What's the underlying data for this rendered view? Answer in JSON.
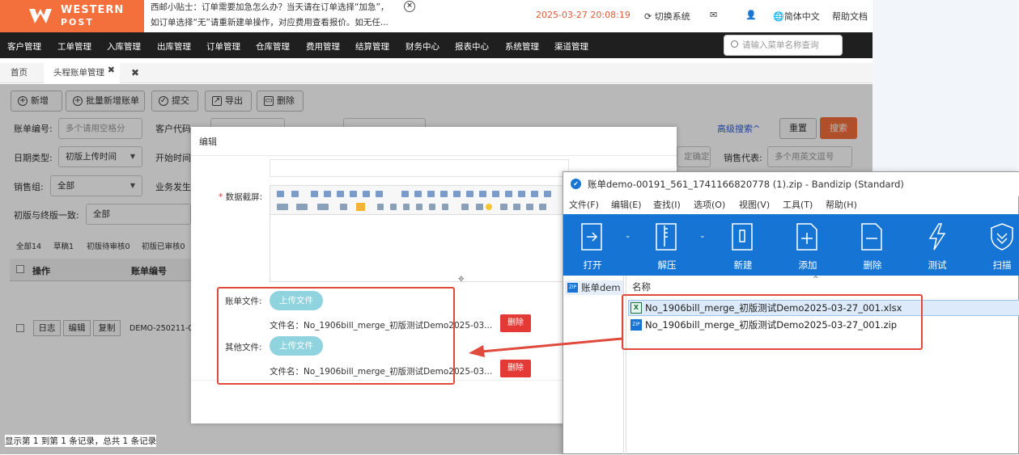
{
  "topbar": {
    "brand_line1": "WESTERN",
    "brand_line2": "POST",
    "tip_line1": "西邮小贴士：订单需要加急怎么办？当天请在订单选择“加急”，",
    "tip_line2": "如订单选择“无”请重新建单操作，对应费用查看报价。如无任...",
    "datetime": "2025-03-27 20:08:19",
    "switch_system": "切换系统",
    "language": "简体中文",
    "help_doc": "帮助文档",
    "menu_search_placeholder": "请输入菜单名称查询",
    "nav": [
      "客户管理",
      "工单管理",
      "入库管理",
      "出库管理",
      "订单管理",
      "仓库管理",
      "费用管理",
      "结算管理",
      "财务中心",
      "报表中心",
      "系统管理",
      "渠道管理"
    ]
  },
  "tabs": {
    "home": "首页",
    "current": "头程账单管理"
  },
  "actions": {
    "add": "新增",
    "batch_add": "批量新增账单",
    "submit": "提交",
    "export": "导出",
    "delete": "删除"
  },
  "filters": {
    "bill_no_label": "账单编号:",
    "bill_no_placeholder": "多个请用空格分",
    "customer_code_label": "客户代码",
    "date_type_label": "日期类型:",
    "date_type_value": "初版上传时间",
    "start_time_label": "开始时间",
    "sales_group_label": "销售组:",
    "sales_group_value": "全部",
    "business_label": "业务发生",
    "consistency_label": "初版与终版一致:",
    "consistency_value": "全部",
    "advanced_search": "高级搜索^",
    "reset": "重置",
    "search": "搜索",
    "sales_rep_label": "销售代表:",
    "sales_rep_placeholder": "多个用英文逗号",
    "confirm_partial": "定确定"
  },
  "subtabs": [
    "全部14",
    "草稿1",
    "初版待审核0",
    "初版已审核0"
  ],
  "table": {
    "headers": [
      "操作",
      "账单编号"
    ],
    "row": {
      "log": "日志",
      "edit": "编辑",
      "copy": "复制",
      "bill_no": "DEMO-250211-0"
    }
  },
  "footer": "显示第 1 到第 1 条记录，总共 1 条记录",
  "dialog": {
    "title": "编辑",
    "data_screenshot_label": "数据截屏:",
    "bill_file_label": "账单文件:",
    "other_file_label": "其他文件:",
    "upload_label": "上传文件",
    "filename1": "文件名：No_1906bill_merge_初版测试Demo2025-03...",
    "filename2": "文件名：No_1906bill_merge_初版测试Demo2025-03...",
    "delete_label": "删除"
  },
  "bandizip": {
    "title": "账单demo-00191_561_1741166820778 (1).zip - Bandizip (Standard)",
    "menu": [
      "文件(F)",
      "编辑(E)",
      "查找(I)",
      "选项(O)",
      "视图(V)",
      "工具(T)",
      "帮助(H)"
    ],
    "tools": [
      "打开",
      "解压",
      "新建",
      "添加",
      "删除",
      "测试",
      "扫描"
    ],
    "tree_root": "账单dem",
    "column_name": "名称",
    "files": [
      "No_1906bill_merge_初版测试Demo2025-03-27_001.xlsx",
      "No_1906bill_merge_初版测试Demo2025-03-27_001.zip"
    ]
  },
  "colors": {
    "brand": "#f36f3b",
    "nav_bg": "#1f1f1f",
    "upload": "#8ed3dd",
    "danger": "#e53935",
    "bandizip_toolbar": "#1574d4",
    "annotation": "#e04a3c"
  }
}
